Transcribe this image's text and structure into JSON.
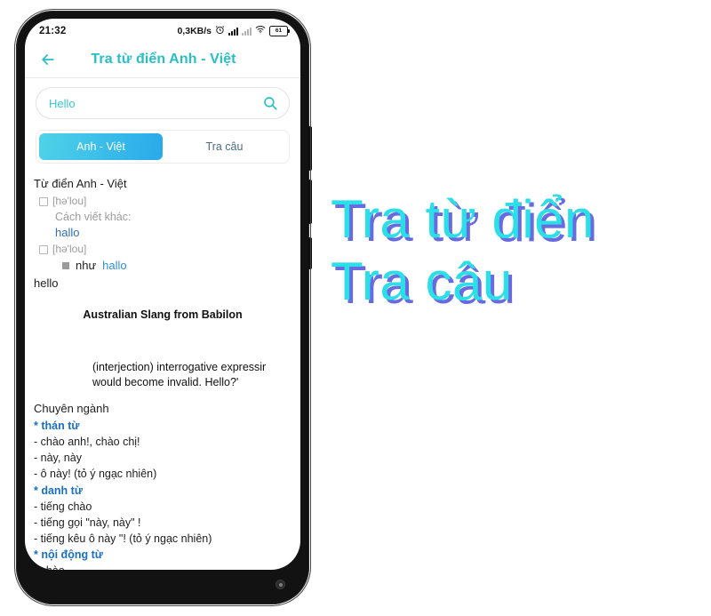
{
  "status_bar": {
    "time": "21:32",
    "net_speed": "0,3KB/s",
    "alarm_icon": "alarm-clock-icon",
    "signal_icon": "signal-bars-icon",
    "signal_secondary_icon": "signal-bars-dim-icon",
    "wifi_icon": "wifi-icon",
    "battery_level": "61"
  },
  "header": {
    "back_icon": "back-arrow-icon",
    "title": "Tra từ điển Anh - Việt"
  },
  "search": {
    "value": "Hello",
    "placeholder": "Hello",
    "icon": "search-icon"
  },
  "tabs": [
    {
      "label": "Anh - Việt",
      "active": true
    },
    {
      "label": "Tra câu",
      "active": false
    }
  ],
  "content": {
    "dictionary_title": "Từ điển Anh - Việt",
    "entry_one": {
      "pronunciation": "[hə'lou]",
      "alt_spelling_label": "Cách viết khác:",
      "alt_spelling_word": "hallo"
    },
    "entry_two": {
      "pronunciation": "[hə'lou]",
      "like_label": "như",
      "like_word": "hallo"
    },
    "headword": "hello",
    "slang_title": "Australian Slang from Babilon",
    "slang_body_line1": "(interjection) interrogative expressir",
    "slang_body_line2": "would become invalid. Hello?'",
    "specialty_title": "Chuyên ngành",
    "sections": [
      {
        "pos": "* thán từ",
        "definitions": [
          "- chào anh!, chào chị!",
          "- này, này",
          "- ô này! (tỏ ý ngạc nhiên)"
        ]
      },
      {
        "pos": "* danh từ",
        "definitions": [
          "- tiếng chào",
          "- tiếng gọi \"này, này\" !",
          "- tiếng kêu ô này \"! (tỏ ý ngạc nhiên)"
        ]
      },
      {
        "pos": "* nội động từ",
        "definitions": [
          "- chào"
        ]
      }
    ]
  },
  "hero": {
    "line1": "Tra từ điển",
    "line2": "Tra câu"
  },
  "colors": {
    "teal": "#27bfc4",
    "tab_gradient_start": "#4fd3e8",
    "tab_gradient_end": "#29a9ea",
    "link_blue": "#2f6fb5",
    "pos_blue": "#1a6fc4",
    "hero_cyan": "#2adfe8",
    "hero_shadow": "#6a6ae0"
  }
}
